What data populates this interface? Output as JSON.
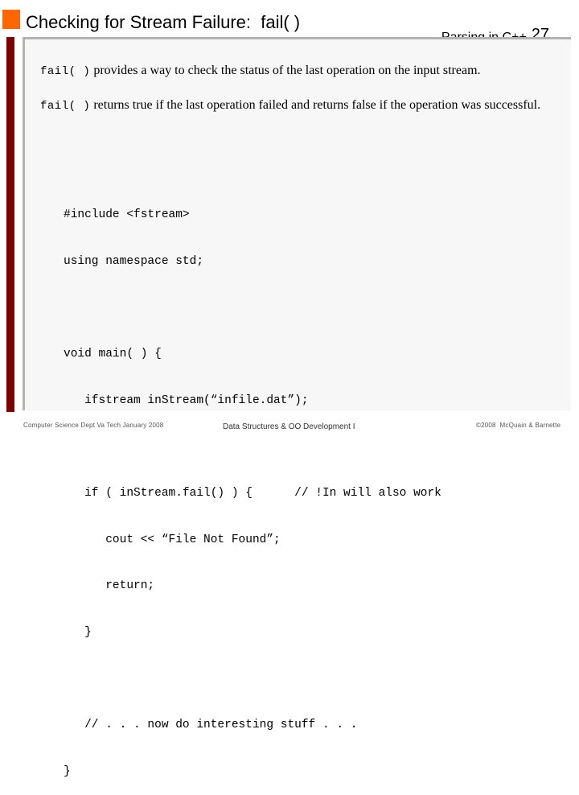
{
  "header": {
    "title": "Checking for Stream Failure:  fail( )",
    "topic": "Parsing in C++",
    "page_number": "27",
    "accent_color": "#ff6600",
    "sidebar_color": "#7b0000"
  },
  "body": {
    "paragraphs": [
      {
        "code": "fail( )",
        "text": " provides a way to check the status of the last operation on the input stream."
      },
      {
        "code": "fail( )",
        "text": " returns true if the last operation failed and returns false if the operation was successful."
      }
    ],
    "code_lines": [
      "#include <fstream>",
      "using namespace std;",
      "",
      "void main( ) {",
      "   ifstream inStream(“infile.dat”);",
      "",
      "   if ( inStream.fail() ) {      // !In will also work",
      "      cout << “File Not Found”;",
      "      return;",
      "   }",
      "",
      "   // . . . now do interesting stuff . . .",
      "}"
    ]
  },
  "footer": {
    "left": "Computer Science Dept Va Tech January 2008",
    "center": "Data Structures & OO Development I",
    "right": "©2008  McQuain & Barnette"
  }
}
